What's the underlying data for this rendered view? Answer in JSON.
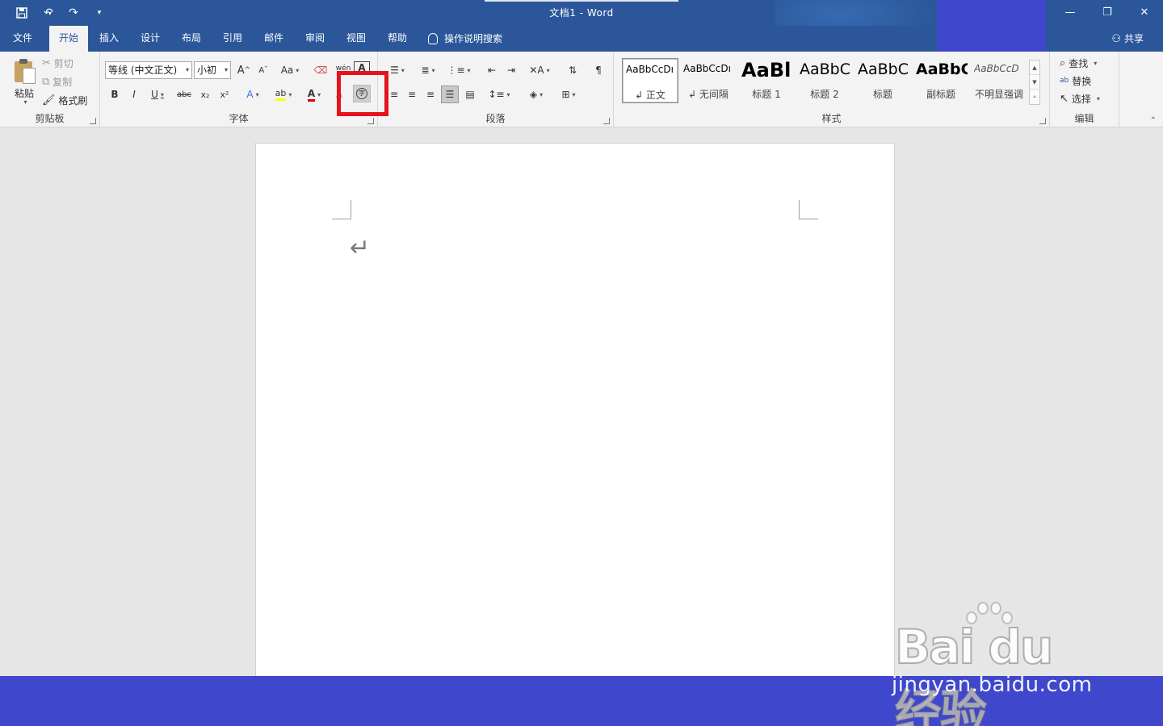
{
  "window": {
    "title": "文档1  -  Word"
  },
  "qat": {
    "save": "save",
    "undo": "undo",
    "redo": "redo",
    "customize": "customize"
  },
  "tabs": [
    {
      "label": "文件"
    },
    {
      "label": "开始"
    },
    {
      "label": "插入"
    },
    {
      "label": "设计"
    },
    {
      "label": "布局"
    },
    {
      "label": "引用"
    },
    {
      "label": "邮件"
    },
    {
      "label": "审阅"
    },
    {
      "label": "视图"
    },
    {
      "label": "帮助"
    }
  ],
  "tell_me": "操作说明搜索",
  "share": "共享",
  "clipboard": {
    "paste": "粘贴",
    "cut": "剪切",
    "copy": "复制",
    "format_painter": "格式刷",
    "label": "剪贴板"
  },
  "font": {
    "family": "等线 (中文正文)",
    "size": "小初",
    "label": "字体",
    "grow": "A",
    "shrink": "A",
    "change_case": "Aa",
    "phonetic": "wén",
    "bold": "B",
    "italic": "I",
    "underline": "U",
    "strike": "abc",
    "subscript": "x₂",
    "superscript": "x²",
    "enclosed_char": "字"
  },
  "paragraph": {
    "label": "段落"
  },
  "styles": {
    "label": "样式",
    "items": [
      {
        "preview": "AaBbCcDı",
        "name": "↲ 正文"
      },
      {
        "preview": "AaBbCcDı",
        "name": "↲ 无间隔"
      },
      {
        "preview": "AaBl",
        "name": "标题 1"
      },
      {
        "preview": "AaBbC",
        "name": "标题 2"
      },
      {
        "preview": "AaBbC",
        "name": "标题"
      },
      {
        "preview": "AaBbC",
        "name": "副标题"
      },
      {
        "preview": "AaBbCcD",
        "name": "不明显强调"
      }
    ]
  },
  "editing": {
    "find": "查找",
    "replace": "替换",
    "select": "选择",
    "label": "编辑"
  },
  "document": {
    "paragraph_mark": "↵"
  },
  "watermark": {
    "brand": "Bai du 经验",
    "url": "jingyan.baidu.com"
  },
  "colors": {
    "titlebar": "#2b579a",
    "ribbon": "#f3f3f3",
    "highlight": "#e5131b",
    "overlay": "#3f48cc"
  }
}
